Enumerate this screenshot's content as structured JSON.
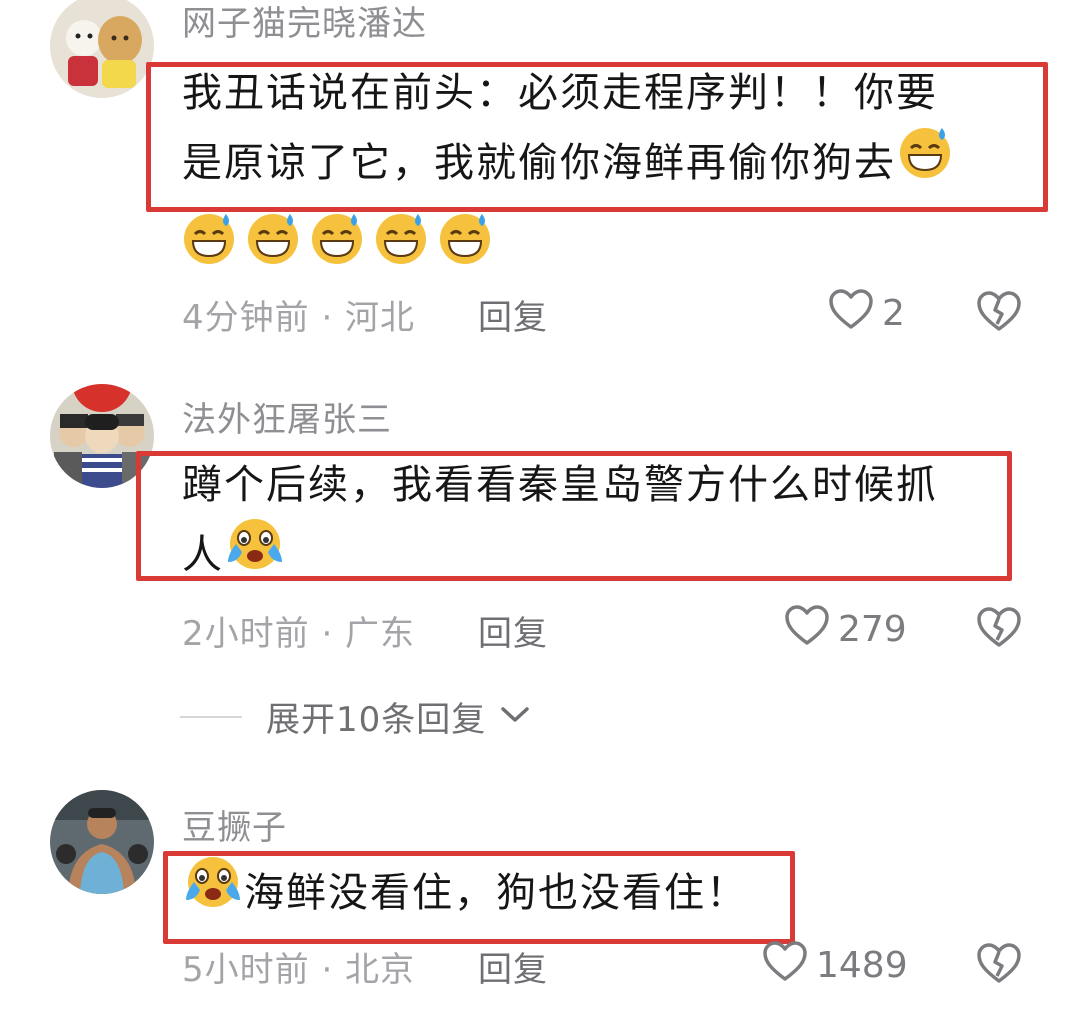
{
  "comments": [
    {
      "username": "网子猫完晓潘达",
      "lines": [
        "我丑话说在前头：必须走程序判！！你要",
        "是原谅了它，我就偷你海鲜再偷你狗去"
      ],
      "emojis": [
        "sweat-smile-emoji",
        "sweat-smile-emoji",
        "sweat-smile-emoji",
        "sweat-smile-emoji",
        "sweat-smile-emoji",
        "sweat-smile-emoji"
      ],
      "time_location": "4分钟前 · 河北",
      "reply_label": "回复",
      "likes": "2"
    },
    {
      "username": "法外狂屠张三",
      "lines": [
        "蹲个后续，我看看秦皇岛警方什么时候抓",
        "人"
      ],
      "emojis": [
        "crying-laugh-emoji"
      ],
      "time_location": "2小时前 · 广东",
      "reply_label": "回复",
      "likes": "279"
    },
    {
      "username": "豆撅子",
      "lines": [
        "海鲜没看住，狗也没看住！"
      ],
      "emojis": [
        "crying-laugh-emoji"
      ],
      "time_location": "5小时前 · 北京",
      "reply_label": "回复",
      "likes": "1489"
    }
  ],
  "expand_replies": "展开10条回复",
  "colors": {
    "highlight": "#d93a35",
    "meta_text": "#a4a4a8",
    "username": "#8e8e93"
  }
}
